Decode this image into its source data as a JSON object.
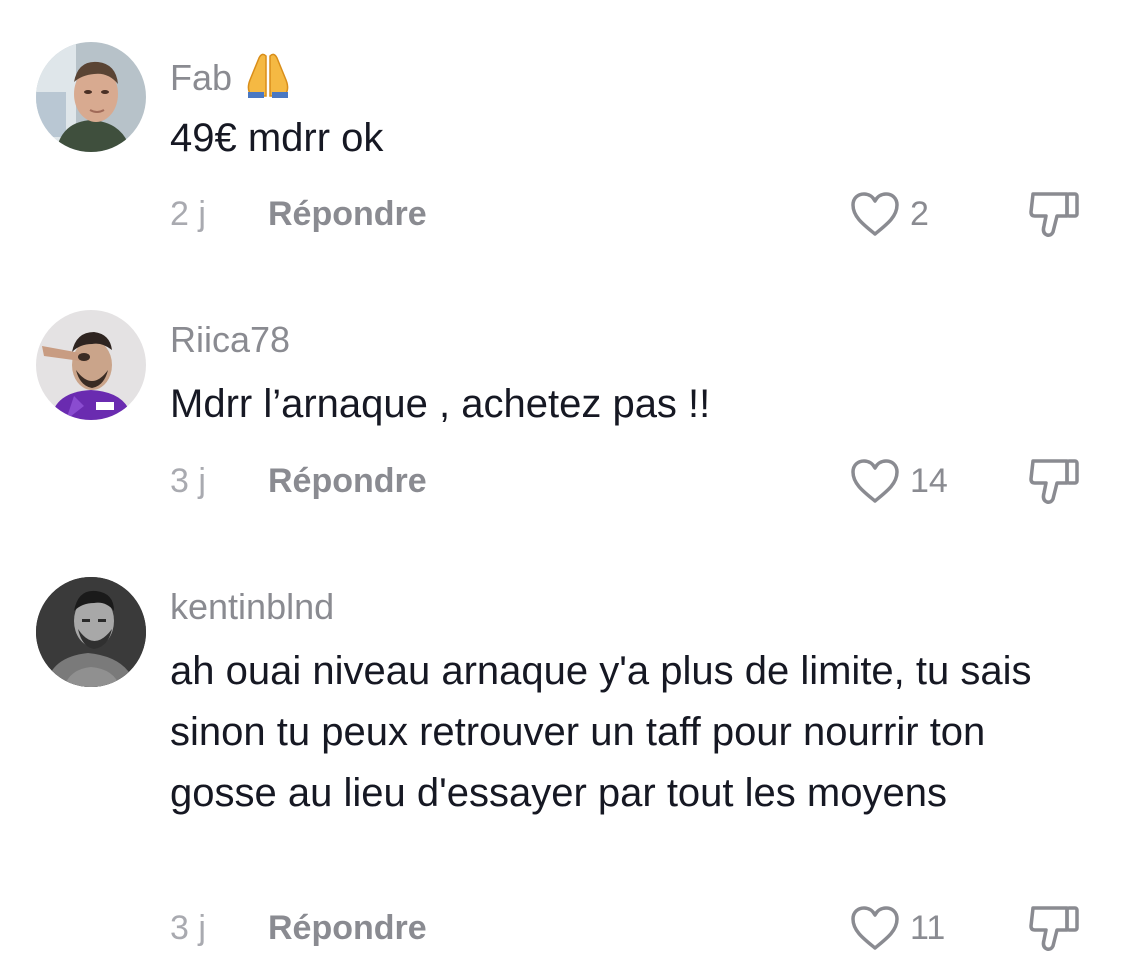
{
  "comments": [
    {
      "username": "Fab",
      "username_emoji": "🙏",
      "text": "49€ mdrr ok",
      "date": "2 j",
      "reply_label": "Répondre",
      "likes": "2"
    },
    {
      "username": "Riica78",
      "text": "Mdrr l’arnaque , achetez pas !!",
      "date": "3 j",
      "reply_label": "Répondre",
      "likes": "14"
    },
    {
      "username": "kentinblnd",
      "text": "ah ouai niveau arnaque y'a plus de limite, tu sais sinon tu peux retrouver un taff pour nourrir ton gosse au lieu d'essayer par tout les moyens",
      "date": "3 j",
      "reply_label": "Répondre",
      "likes": "11"
    }
  ],
  "icons": {
    "like": "heart-outline-icon",
    "dislike": "thumbs-down-outline-icon"
  },
  "colors": {
    "text": "#161823",
    "secondary": "#8a8b91",
    "date": "#a9aab0"
  }
}
